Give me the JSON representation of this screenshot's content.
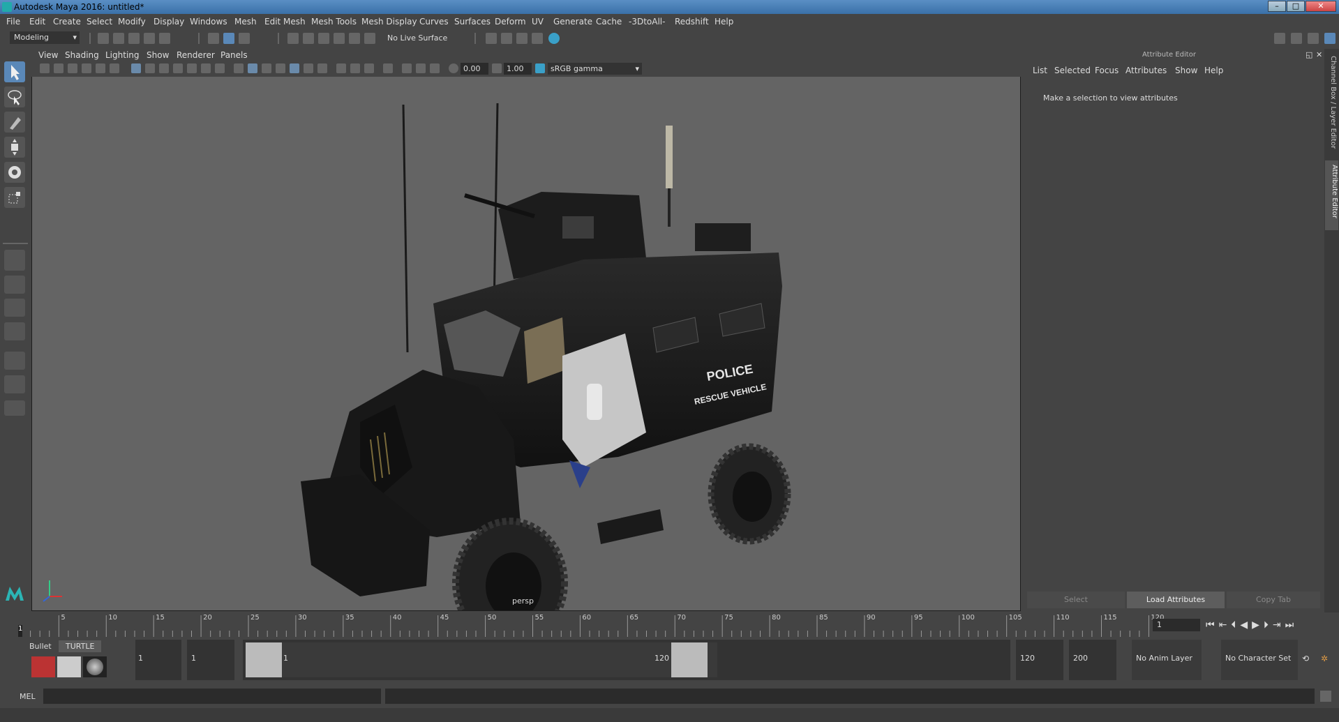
{
  "window": {
    "title": "Autodesk Maya 2016: untitled*",
    "min": "–",
    "max": "□",
    "close": "✕"
  },
  "menus": [
    "File",
    "Edit",
    "Create",
    "Select",
    "Modify",
    "Display",
    "Windows",
    "Mesh",
    "Edit Mesh",
    "Mesh Tools",
    "Mesh Display",
    "Curves",
    "Surfaces",
    "Deform",
    "UV",
    "Generate",
    "Cache",
    "-3DtoAll-",
    "Redshift",
    "Help"
  ],
  "shelf": {
    "mode": "Modeling",
    "live_surface": "No Live Surface"
  },
  "viewport": {
    "menus": [
      "View",
      "Shading",
      "Lighting",
      "Show",
      "Renderer",
      "Panels"
    ],
    "exposure": "0.00",
    "gamma": "1.00",
    "color_space": "sRGB gamma",
    "camera_label": "persp",
    "vehicle_text_1": "POLICE",
    "vehicle_text_2": "RESCUE VEHICLE"
  },
  "attribute_editor": {
    "title": "Attribute Editor",
    "menus": [
      "List",
      "Selected",
      "Focus",
      "Attributes",
      "Show",
      "Help"
    ],
    "message": "Make a selection to view attributes",
    "buttons": {
      "select": "Select",
      "load": "Load Attributes",
      "copy": "Copy Tab"
    }
  },
  "side_tabs": {
    "channel_box": "Channel Box / Layer Editor",
    "attr_editor": "Attribute Editor"
  },
  "timeline": {
    "ticks": [
      "5",
      "10",
      "15",
      "20",
      "25",
      "30",
      "35",
      "40",
      "45",
      "50",
      "55",
      "60",
      "65",
      "70",
      "75",
      "80",
      "85",
      "90",
      "95",
      "100",
      "105",
      "110",
      "115",
      "120"
    ],
    "current_frame_marker": "1",
    "current_frame_field": "1"
  },
  "range": {
    "shelf_tabs": [
      "Bullet",
      "TURTLE"
    ],
    "start": "1",
    "playback_start": "1",
    "slider_start": "1",
    "slider_end": "120",
    "playback_end": "120",
    "end": "200",
    "anim_layer": "No Anim Layer",
    "character_set": "No Character Set"
  },
  "command": {
    "lang": "MEL"
  }
}
